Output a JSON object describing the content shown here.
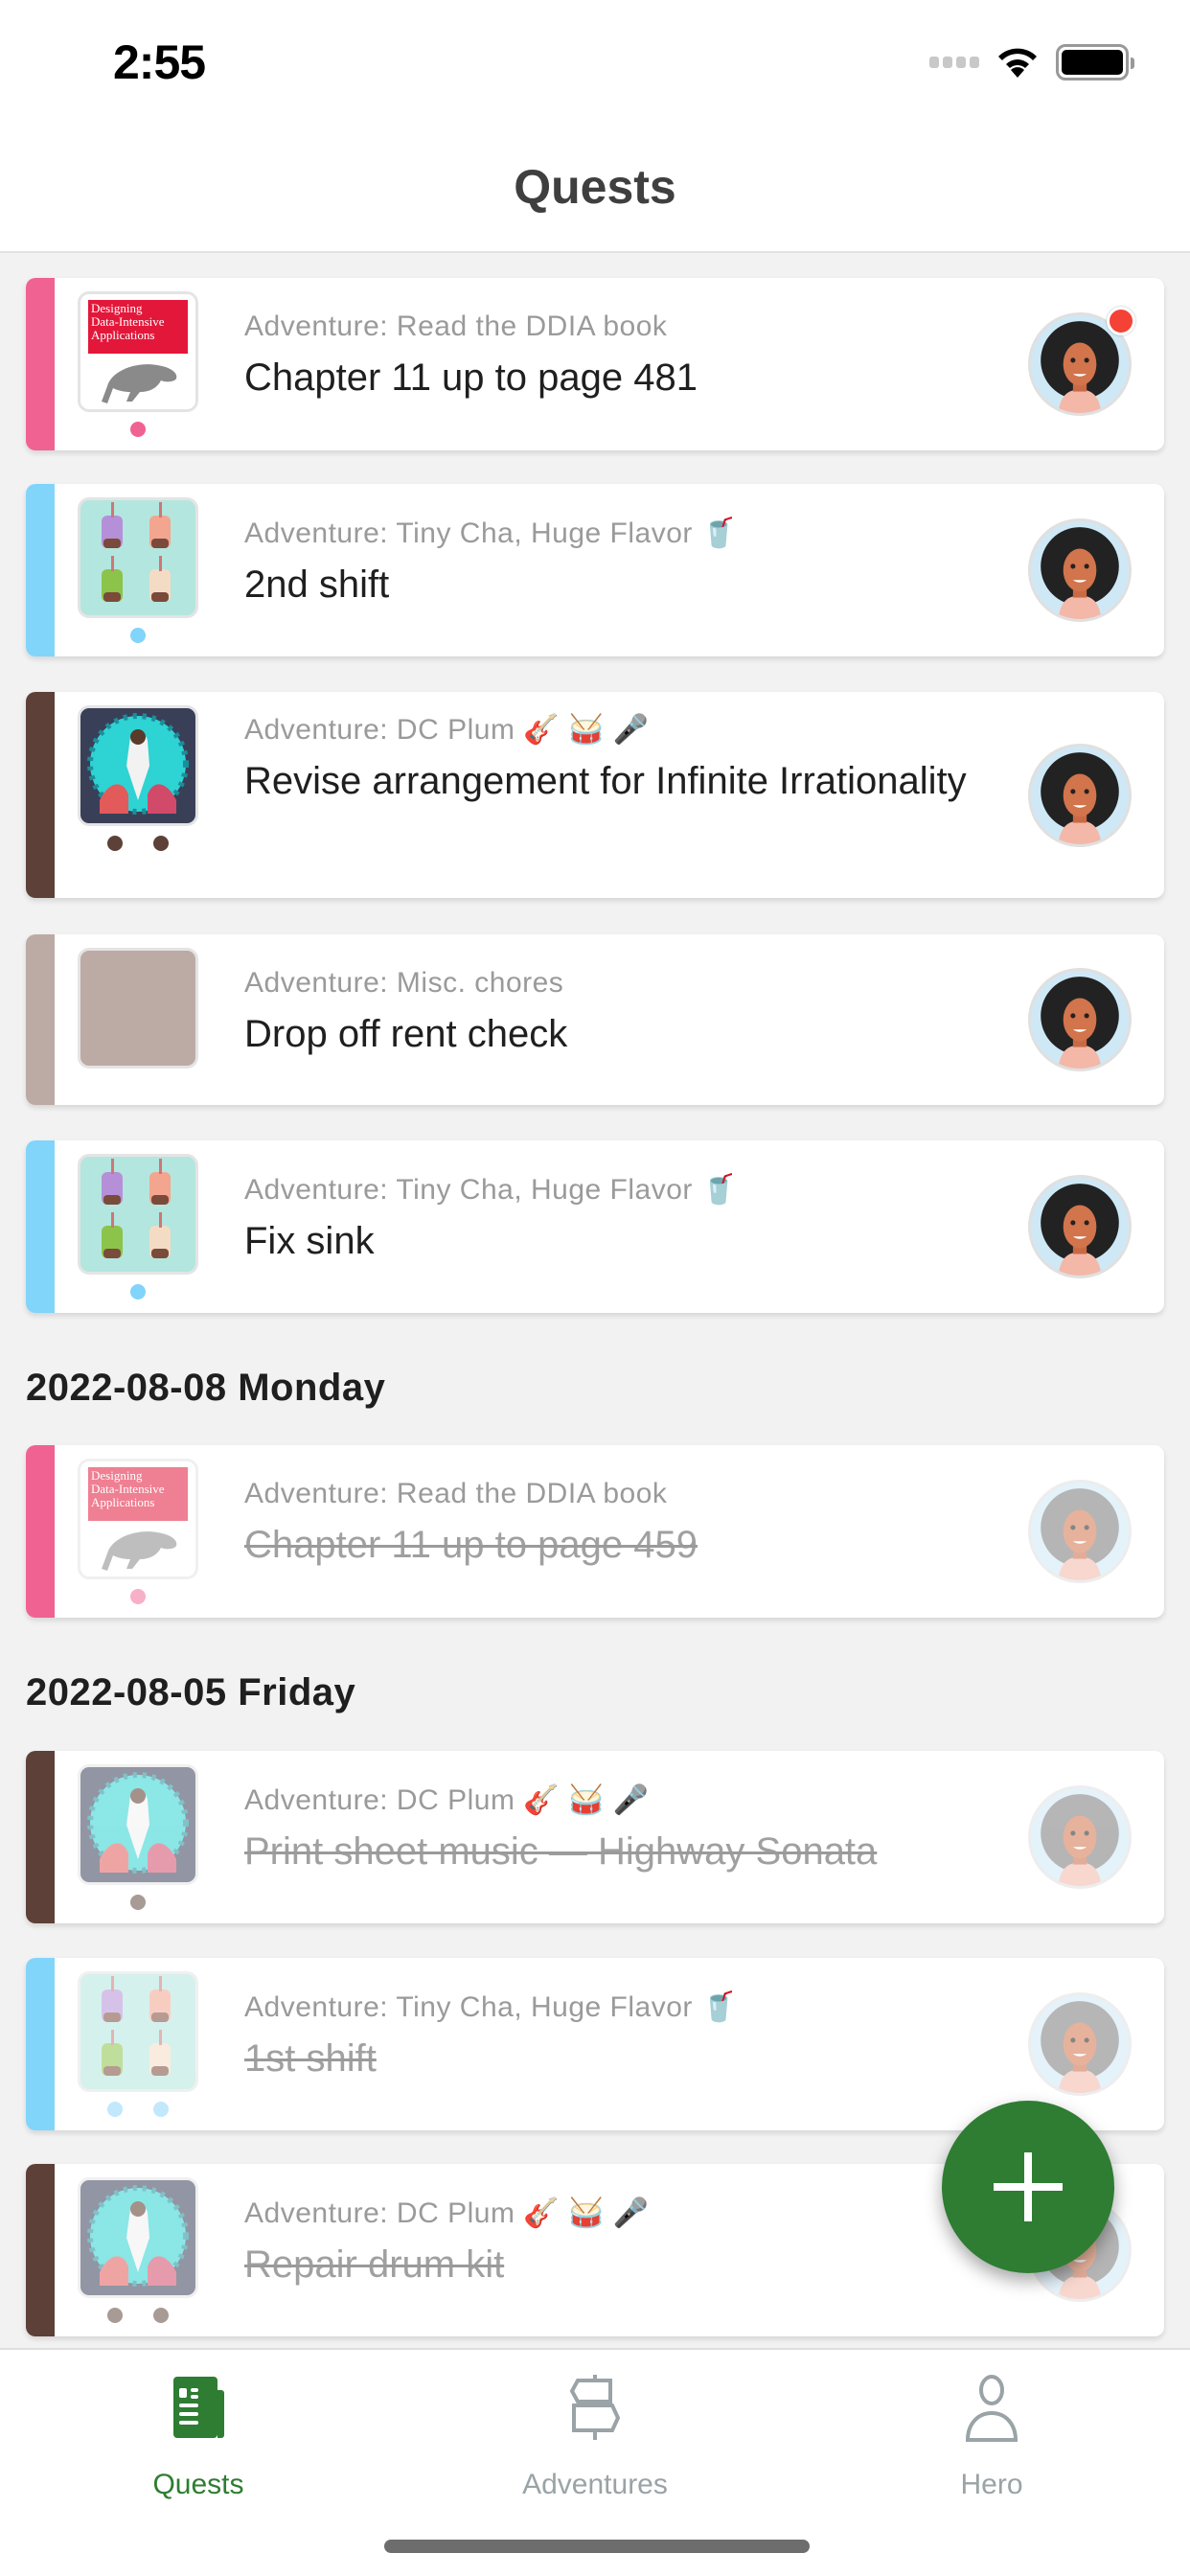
{
  "status_bar": {
    "time": "2:55"
  },
  "header": {
    "title": "Quests"
  },
  "colors": {
    "accent": "#2e7d32",
    "ddia": "#f06292",
    "tiny_cha": "#81d4fa",
    "dc_plum": "#5d4037",
    "misc": "#bcaaa4",
    "badge": "#f44336"
  },
  "quests_current": [
    {
      "adventure": "Adventure: Read the DDIA book",
      "title": "Chapter 11 up to page 481",
      "thumb": "ddia-book-cover",
      "dots": 1,
      "notification_badge": true,
      "completed": false
    },
    {
      "adventure": "Adventure: Tiny Cha, Huge Flavor 🥤",
      "title": "2nd shift",
      "thumb": "boba-drinks",
      "dots": 1,
      "notification_badge": false,
      "completed": false
    },
    {
      "adventure": "Adventure: DC Plum 🎸 🥁 🎤",
      "title": "Revise arrangement for Infinite Irrationality",
      "thumb": "band-concert",
      "dots": 2,
      "notification_badge": false,
      "completed": false
    },
    {
      "adventure": "Adventure: Misc. chores",
      "title": "Drop off rent check",
      "thumb": "plain-swatch",
      "dots": 0,
      "notification_badge": false,
      "completed": false
    },
    {
      "adventure": "Adventure: Tiny Cha, Huge Flavor 🥤",
      "title": "Fix sink",
      "thumb": "boba-drinks",
      "dots": 1,
      "notification_badge": false,
      "completed": false
    }
  ],
  "sections": [
    {
      "header": "2022-08-08 Monday",
      "quests": [
        {
          "adventure": "Adventure: Read the DDIA book",
          "title": "Chapter 11 up to page 459",
          "thumb": "ddia-book-cover",
          "dots": 1,
          "completed": true
        }
      ]
    },
    {
      "header": "2022-08-05 Friday",
      "quests": [
        {
          "adventure": "Adventure: DC Plum 🎸 🥁 🎤",
          "title": "Print sheet music — Highway Sonata",
          "thumb": "band-concert",
          "dots": 1,
          "completed": true
        },
        {
          "adventure": "Adventure: Tiny Cha, Huge Flavor 🥤",
          "title": "1st shift",
          "thumb": "boba-drinks",
          "dots": 2,
          "completed": true
        },
        {
          "adventure": "Adventure: DC Plum 🎸 🥁 🎤",
          "title": "Repair drum kit",
          "thumb": "band-concert",
          "dots": 2,
          "completed": true
        }
      ]
    }
  ],
  "fab": {
    "icon": "plus-icon",
    "label": "Add quest"
  },
  "tabs": [
    {
      "label": "Quests",
      "icon": "newspaper-icon",
      "active": true
    },
    {
      "label": "Adventures",
      "icon": "signpost-icon",
      "active": false
    },
    {
      "label": "Hero",
      "icon": "person-icon",
      "active": false
    }
  ]
}
